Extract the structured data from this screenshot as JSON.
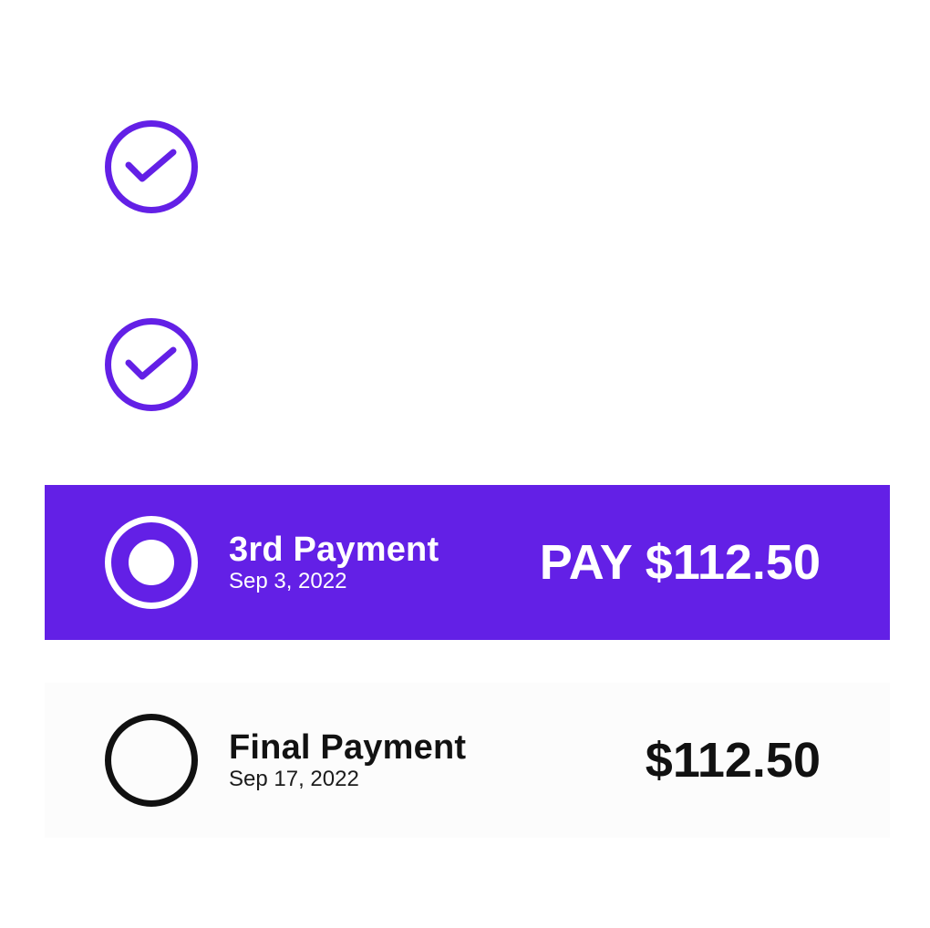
{
  "colors": {
    "accent": "#6320e6",
    "active_text": "#ffffff",
    "pending_ring": "#111111",
    "background": "#ffffff"
  },
  "payments": [
    {
      "status": "paid",
      "icon": "check-circle-icon"
    },
    {
      "status": "paid",
      "icon": "check-circle-icon"
    },
    {
      "status": "due",
      "icon": "radio-selected-icon",
      "title": "3rd Payment",
      "date": "Sep 3, 2022",
      "action_label": "PAY $112.50"
    },
    {
      "status": "upcoming",
      "icon": "radio-empty-icon",
      "title": "Final Payment",
      "date": "Sep 17, 2022",
      "amount": "$112.50"
    }
  ]
}
